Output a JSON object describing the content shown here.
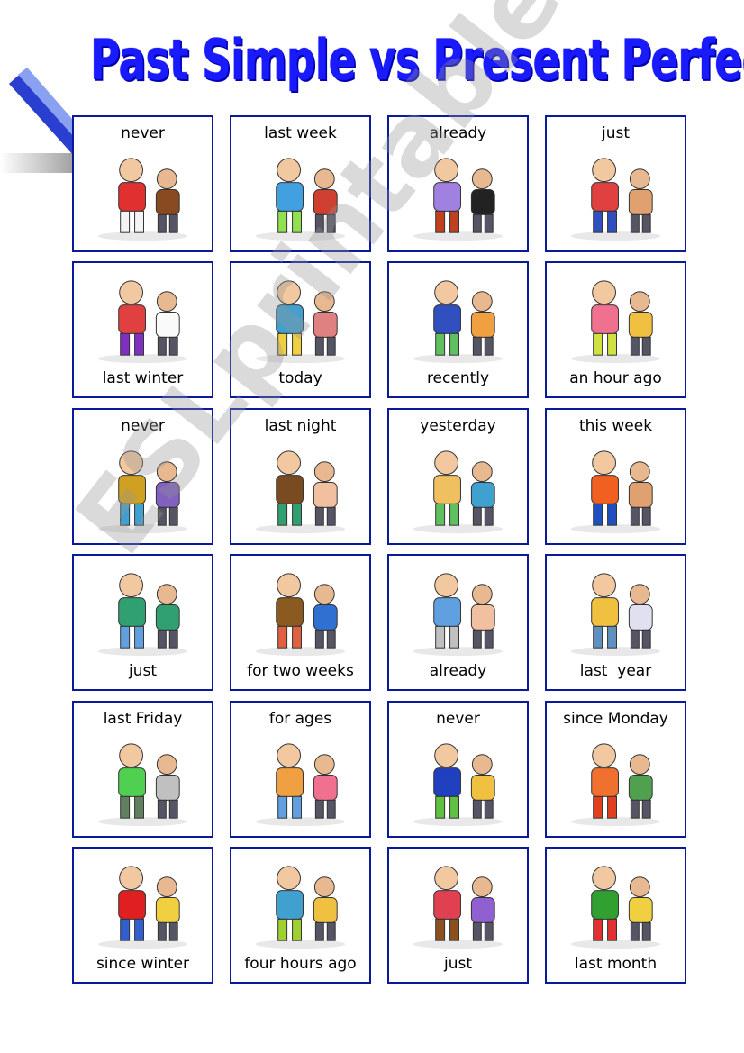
{
  "title": "Past Simple vs Present Perfect",
  "watermark": "ESLprintables.com",
  "colors": {
    "title": "#1a1aff",
    "card_border": "#0a1a9a"
  },
  "cards": [
    {
      "label": "never",
      "label_position": "top",
      "image": "ice-hockey-player"
    },
    {
      "label": "last week",
      "label_position": "top",
      "image": "girl-snorkeling"
    },
    {
      "label": "already",
      "label_position": "top",
      "image": "couple-dancing"
    },
    {
      "label": "just",
      "label_position": "top",
      "image": "boy-with-toy-truck"
    },
    {
      "label": "last winter",
      "label_position": "bottom",
      "image": "kids-building-snowman"
    },
    {
      "label": "today",
      "label_position": "bottom",
      "image": "girl-swimming"
    },
    {
      "label": "recently",
      "label_position": "bottom",
      "image": "man-watering-flower"
    },
    {
      "label": "an hour ago",
      "label_position": "bottom",
      "image": "kids-singing-microphone"
    },
    {
      "label": "never",
      "label_position": "top",
      "image": "girl-with-big-prize-trophy"
    },
    {
      "label": "last night",
      "label_position": "top",
      "image": "man-in-hammock"
    },
    {
      "label": "yesterday",
      "label_position": "top",
      "image": "kids-singing"
    },
    {
      "label": "this week",
      "label_position": "top",
      "image": "boy-playing-football"
    },
    {
      "label": "just",
      "label_position": "bottom",
      "image": "girl-playing-video-game"
    },
    {
      "label": "for two weeks",
      "label_position": "bottom",
      "image": "business-meeting"
    },
    {
      "label": "already",
      "label_position": "bottom",
      "image": "boy-at-mirror"
    },
    {
      "label": "last  year",
      "label_position": "bottom",
      "image": "tourist-with-map"
    },
    {
      "label": "last Friday",
      "label_position": "top",
      "image": "man-washing-car"
    },
    {
      "label": "for ages",
      "label_position": "top",
      "image": "friends-talking"
    },
    {
      "label": "never",
      "label_position": "top",
      "image": "family-on-train"
    },
    {
      "label": "since Monday",
      "label_position": "top",
      "image": "boy-reading"
    },
    {
      "label": "since winter",
      "label_position": "bottom",
      "image": "kids-sledding"
    },
    {
      "label": "four hours ago",
      "label_position": "bottom",
      "image": "kids-dancing"
    },
    {
      "label": "just",
      "label_position": "bottom",
      "image": "man-at-computer"
    },
    {
      "label": "last month",
      "label_position": "bottom",
      "image": "people-playing-golf"
    }
  ]
}
